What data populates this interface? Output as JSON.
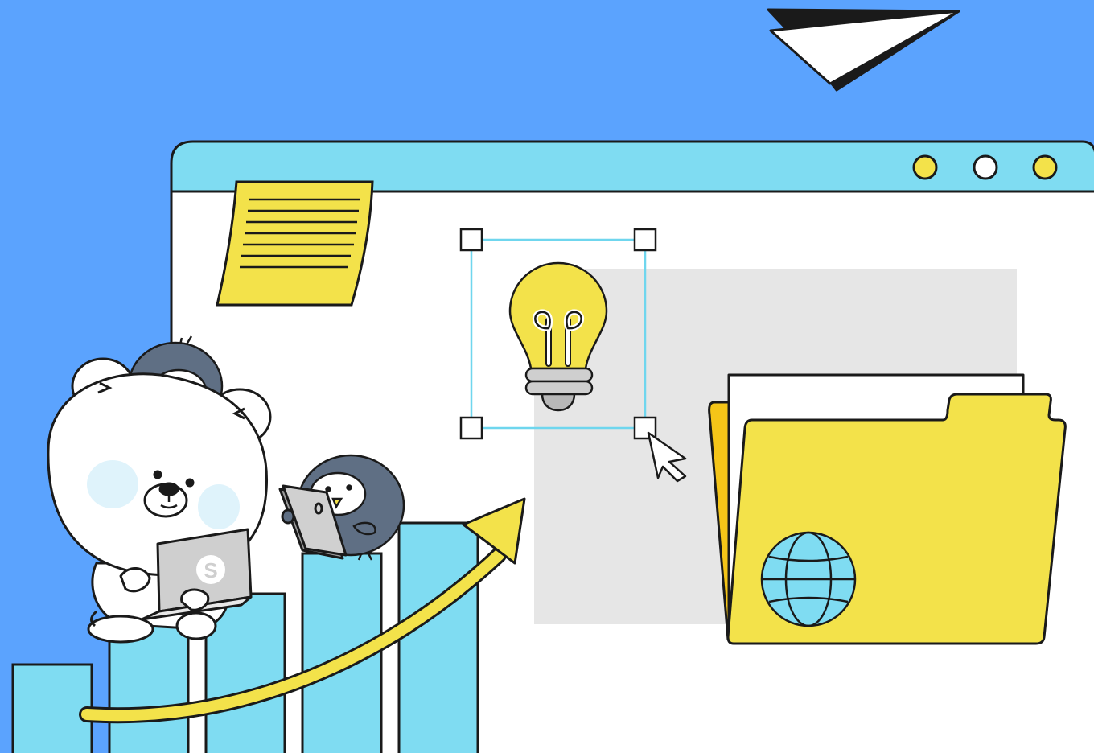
{
  "colors": {
    "background": "#5ba3fe",
    "window_titlebar": "#7fdcf2",
    "window_body": "#ffffff",
    "yellow": "#f3e24a",
    "bar_blue": "#7fdcf2",
    "gray_area": "#e6e6e6",
    "selection_frame": "#6fd6ee",
    "outline": "#1a1a1a",
    "penguin": "#5f6f84",
    "cheek": "#dff3fb"
  },
  "window": {
    "controls": [
      {
        "name": "yellow-dot",
        "color": "#f3e24a"
      },
      {
        "name": "white-dot",
        "color": "#ffffff"
      },
      {
        "name": "yellow-dot",
        "color": "#f3e24a"
      }
    ]
  },
  "laptop_logo": "S",
  "icons": [
    "paper-plane-icon",
    "sticky-note-icon",
    "lightbulb-icon",
    "cursor-icon",
    "folder-icon",
    "globe-icon",
    "growth-arrow-icon",
    "tablet-icon",
    "laptop-icon"
  ]
}
